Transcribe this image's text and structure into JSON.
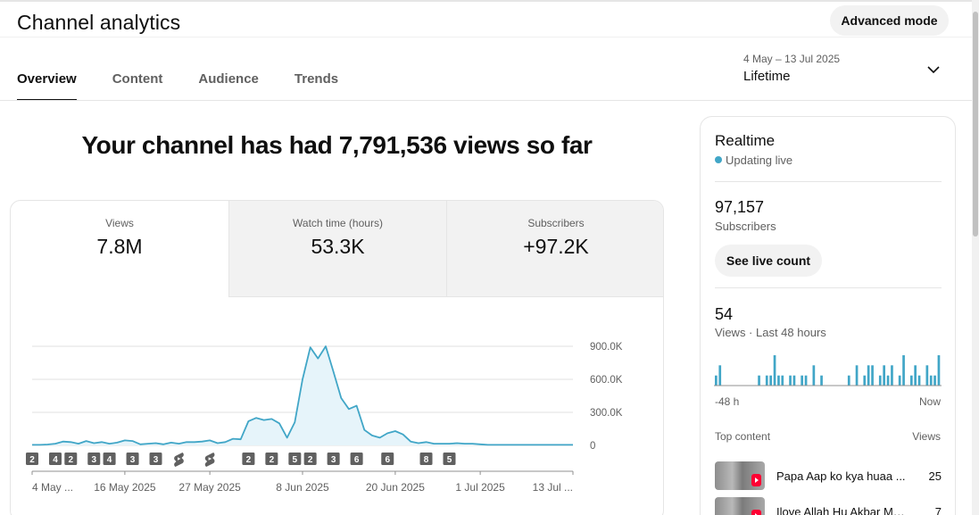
{
  "header": {
    "title": "Channel analytics",
    "advanced_mode": "Advanced mode",
    "tabs": [
      {
        "label": "Overview",
        "active": true
      },
      {
        "label": "Content",
        "active": false
      },
      {
        "label": "Audience",
        "active": false
      },
      {
        "label": "Trends",
        "active": false
      }
    ],
    "date_range": "4 May – 13 Jul 2025",
    "period": "Lifetime"
  },
  "main": {
    "headline": "Your channel has had 7,791,536 views so far",
    "metrics": [
      {
        "label": "Views",
        "value": "7.8M"
      },
      {
        "label": "Watch time (hours)",
        "value": "53.3K"
      },
      {
        "label": "Subscribers",
        "value": "+97.2K"
      }
    ]
  },
  "chart_data": {
    "type": "area",
    "title": "",
    "xlabel": "",
    "ylabel": "",
    "series_color": "#41a6c7",
    "fill_color": "#e6f4fa",
    "x_range": [
      "2025-05-04",
      "2025-07-13"
    ],
    "x": [
      "2025-05-04",
      "2025-05-05",
      "2025-05-06",
      "2025-05-07",
      "2025-05-08",
      "2025-05-09",
      "2025-05-10",
      "2025-05-11",
      "2025-05-12",
      "2025-05-13",
      "2025-05-14",
      "2025-05-15",
      "2025-05-16",
      "2025-05-17",
      "2025-05-18",
      "2025-05-19",
      "2025-05-20",
      "2025-05-21",
      "2025-05-22",
      "2025-05-23",
      "2025-05-24",
      "2025-05-25",
      "2025-05-26",
      "2025-05-27",
      "2025-05-28",
      "2025-05-29",
      "2025-05-30",
      "2025-05-31",
      "2025-06-01",
      "2025-06-02",
      "2025-06-03",
      "2025-06-04",
      "2025-06-05",
      "2025-06-06",
      "2025-06-07",
      "2025-06-08",
      "2025-06-09",
      "2025-06-10",
      "2025-06-11",
      "2025-06-12",
      "2025-06-13",
      "2025-06-14",
      "2025-06-15",
      "2025-06-16",
      "2025-06-17",
      "2025-06-18",
      "2025-06-19",
      "2025-06-20",
      "2025-06-21",
      "2025-06-22",
      "2025-06-23",
      "2025-06-24",
      "2025-06-25",
      "2025-06-26",
      "2025-06-27",
      "2025-06-28",
      "2025-06-29",
      "2025-06-30",
      "2025-07-01",
      "2025-07-02",
      "2025-07-03",
      "2025-07-04",
      "2025-07-05",
      "2025-07-06",
      "2025-07-07",
      "2025-07-08",
      "2025-07-09",
      "2025-07-10",
      "2025-07-11",
      "2025-07-12",
      "2025-07-13"
    ],
    "values": [
      5000,
      5000,
      8000,
      15000,
      35000,
      30000,
      15000,
      40000,
      20000,
      30000,
      15000,
      25000,
      45000,
      40000,
      10000,
      15000,
      20000,
      10000,
      25000,
      15000,
      30000,
      30000,
      35000,
      45000,
      20000,
      30000,
      60000,
      55000,
      220000,
      250000,
      230000,
      240000,
      200000,
      70000,
      210000,
      600000,
      890000,
      790000,
      900000,
      670000,
      430000,
      330000,
      360000,
      140000,
      90000,
      70000,
      110000,
      130000,
      100000,
      35000,
      20000,
      30000,
      15000,
      15000,
      15000,
      20000,
      15000,
      15000,
      10000,
      5000,
      5000,
      5000,
      5000,
      5000,
      5000,
      5000,
      5000,
      5000,
      5000,
      5000,
      5000
    ],
    "ylim": [
      0,
      900000
    ],
    "yticks": [
      {
        "value": 0,
        "label": "0"
      },
      {
        "value": 300000,
        "label": "300.0K"
      },
      {
        "value": 600000,
        "label": "600.0K"
      },
      {
        "value": 900000,
        "label": "900.0K"
      }
    ],
    "xticks": [
      {
        "date": "2025-05-04",
        "label": "4 May ..."
      },
      {
        "date": "2025-05-16",
        "label": "16 May 2025"
      },
      {
        "date": "2025-05-27",
        "label": "27 May 2025"
      },
      {
        "date": "2025-06-08",
        "label": "8 Jun 2025"
      },
      {
        "date": "2025-06-20",
        "label": "20 Jun 2025"
      },
      {
        "date": "2025-07-01",
        "label": "1 Jul 2025"
      },
      {
        "date": "2025-07-13",
        "label": "13 Jul ..."
      }
    ],
    "grid": true,
    "upload_markers": [
      {
        "date": "2025-05-04",
        "kind": "count",
        "label": "2"
      },
      {
        "date": "2025-05-07",
        "kind": "count",
        "label": "4"
      },
      {
        "date": "2025-05-09",
        "kind": "count",
        "label": "2"
      },
      {
        "date": "2025-05-12",
        "kind": "count",
        "label": "3"
      },
      {
        "date": "2025-05-14",
        "kind": "count",
        "label": "4"
      },
      {
        "date": "2025-05-17",
        "kind": "count",
        "label": "3"
      },
      {
        "date": "2025-05-20",
        "kind": "count",
        "label": "3"
      },
      {
        "date": "2025-05-23",
        "kind": "shorts",
        "label": ""
      },
      {
        "date": "2025-05-27",
        "kind": "shorts",
        "label": ""
      },
      {
        "date": "2025-06-01",
        "kind": "count",
        "label": "2"
      },
      {
        "date": "2025-06-04",
        "kind": "count",
        "label": "2"
      },
      {
        "date": "2025-06-07",
        "kind": "count",
        "label": "5"
      },
      {
        "date": "2025-06-09",
        "kind": "count",
        "label": "2"
      },
      {
        "date": "2025-06-12",
        "kind": "count",
        "label": "3"
      },
      {
        "date": "2025-06-15",
        "kind": "count",
        "label": "6"
      },
      {
        "date": "2025-06-19",
        "kind": "count",
        "label": "6"
      },
      {
        "date": "2025-06-24",
        "kind": "count",
        "label": "8"
      },
      {
        "date": "2025-06-27",
        "kind": "count",
        "label": "5"
      }
    ]
  },
  "realtime": {
    "title": "Realtime",
    "status": "Updating live",
    "status_color": "#41a6c7",
    "subscribers_value": "97,157",
    "subscribers_label": "Subscribers",
    "live_count_button": "See live count",
    "views_value": "54",
    "views_label": "Views · Last 48 hours",
    "axis_start": "-48 h",
    "axis_end": "Now",
    "bars_48h": [
      1,
      2,
      0,
      0,
      0,
      0,
      0,
      0,
      0,
      0,
      0,
      1,
      0,
      1,
      1,
      3,
      1,
      1,
      0,
      1,
      1,
      0,
      1,
      1,
      0,
      2,
      0,
      1,
      0,
      0,
      0,
      0,
      0,
      0,
      1,
      0,
      2,
      0,
      1,
      2,
      2,
      0,
      1,
      2,
      1,
      2,
      0,
      1,
      3,
      0,
      1,
      2,
      1,
      0,
      2,
      1,
      1,
      3
    ],
    "top_content_label": "Top content",
    "top_content_views_label": "Views",
    "top_content": [
      {
        "title": "Papa Aap ko kya huaa ...",
        "views": "25"
      },
      {
        "title": "Ilove Allah Hu Akbar Mu...",
        "views": "7"
      }
    ]
  }
}
